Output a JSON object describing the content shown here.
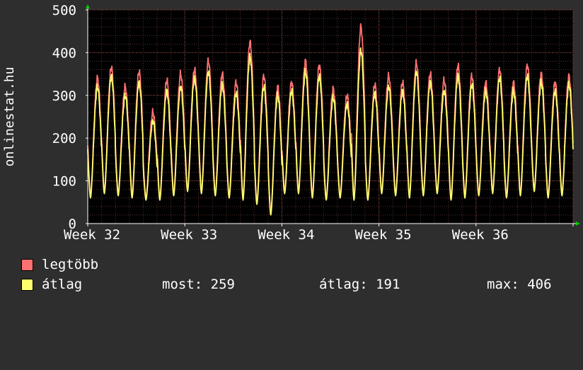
{
  "chart_data": {
    "type": "line",
    "title": "",
    "ylabel": "onlinestat.hu",
    "xlabel": "",
    "ylim": [
      0,
      500
    ],
    "y_ticks": [
      "0",
      "100",
      "200",
      "300",
      "400",
      "500"
    ],
    "x_ticks": [
      "Week 32",
      "Week 33",
      "Week 34",
      "Week 35",
      "Week 36"
    ],
    "x_range_days": [
      0,
      35
    ],
    "grid": true,
    "legend_placement": "bottom-left",
    "series": [
      {
        "name": "legtöbb",
        "color": "#ff7070",
        "daily_peaks": [
          340,
          365,
          320,
          355,
          260,
          335,
          350,
          360,
          380,
          350,
          330,
          425,
          345,
          320,
          330,
          380,
          370,
          315,
          300,
          460,
          325,
          345,
          330,
          375,
          350,
          335,
          370,
          345,
          330,
          360,
          330,
          370,
          350,
          330,
          345
        ],
        "daily_lows": [
          65,
          75,
          70,
          65,
          60,
          60,
          70,
          80,
          75,
          70,
          65,
          60,
          50,
          25,
          75,
          75,
          65,
          60,
          65,
          60,
          60,
          75,
          70,
          65,
          70,
          75,
          60,
          65,
          70,
          75,
          65,
          70,
          80,
          65,
          70
        ]
      },
      {
        "name": "átlag",
        "color": "#ffff70",
        "daily_peaks": [
          320,
          345,
          300,
          330,
          240,
          310,
          320,
          340,
          355,
          325,
          305,
          390,
          320,
          300,
          310,
          355,
          345,
          295,
          280,
          405,
          305,
          320,
          310,
          355,
          330,
          310,
          345,
          325,
          310,
          340,
          310,
          345,
          330,
          310,
          325
        ],
        "daily_lows": [
          60,
          70,
          65,
          60,
          55,
          55,
          65,
          75,
          70,
          65,
          60,
          55,
          45,
          20,
          70,
          70,
          60,
          55,
          60,
          55,
          55,
          70,
          65,
          60,
          65,
          70,
          55,
          60,
          65,
          70,
          60,
          65,
          75,
          60,
          65
        ]
      }
    ]
  },
  "legend": {
    "max_label": "legtöbb",
    "avg_label": "átlag",
    "max_color": "#ff7070",
    "avg_color": "#ffff70",
    "most_text": "most: 259",
    "atlag_text": "átlag: 191",
    "max_text": "max: 406"
  }
}
